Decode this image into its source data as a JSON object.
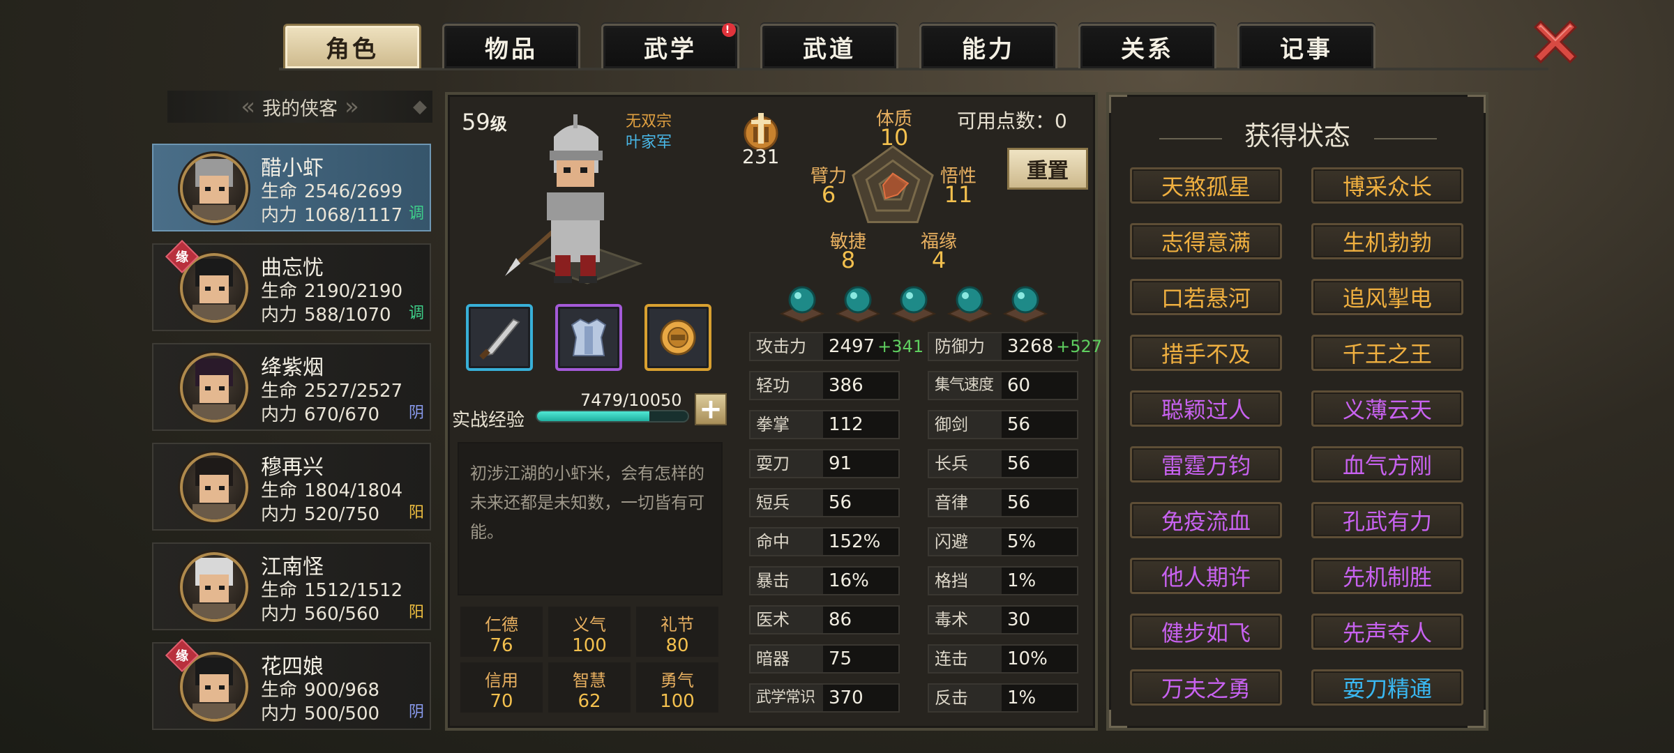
{
  "tabs": [
    {
      "label": "角色",
      "active": true,
      "badge": ""
    },
    {
      "label": "物品",
      "active": false,
      "badge": ""
    },
    {
      "label": "武学",
      "active": false,
      "badge": "!"
    },
    {
      "label": "武道",
      "active": false,
      "badge": ""
    },
    {
      "label": "能力",
      "active": false,
      "badge": ""
    },
    {
      "label": "关系",
      "active": false,
      "badge": ""
    },
    {
      "label": "记事",
      "active": false,
      "badge": ""
    }
  ],
  "character_list": {
    "title": "我的侠客",
    "chars": [
      {
        "name": "醋小虾",
        "hp_label": "生命",
        "hp": "2546/2699",
        "mp_label": "内力",
        "mp": "1068/1117",
        "tag": "调",
        "fate": ""
      },
      {
        "name": "曲忘忧",
        "hp_label": "生命",
        "hp": "2190/2190",
        "mp_label": "内力",
        "mp": "588/1070",
        "tag": "调",
        "fate": "缘"
      },
      {
        "name": "绛紫烟",
        "hp_label": "生命",
        "hp": "2527/2527",
        "mp_label": "内力",
        "mp": "670/670",
        "tag": "阴",
        "fate": ""
      },
      {
        "name": "穆再兴",
        "hp_label": "生命",
        "hp": "1804/1804",
        "mp_label": "内力",
        "mp": "520/750",
        "tag": "阳",
        "fate": ""
      },
      {
        "name": "江南怪",
        "hp_label": "生命",
        "hp": "1512/1512",
        "mp_label": "内力",
        "mp": "560/560",
        "tag": "阳",
        "fate": ""
      },
      {
        "name": "花四娘",
        "hp_label": "生命",
        "hp": "900/968",
        "mp_label": "内力",
        "mp": "500/500",
        "tag": "阴",
        "fate": "缘"
      }
    ]
  },
  "profile": {
    "level_num": "59",
    "level_suffix": "级",
    "sect1": "无双宗",
    "sect2": "叶家军",
    "power": "231",
    "available_points": "可用点数：0",
    "reset_label": "重置",
    "radar": [
      {
        "label": "体质",
        "value": "10"
      },
      {
        "label": "悟性",
        "value": "11"
      },
      {
        "label": "福缘",
        "value": "4"
      },
      {
        "label": "敏捷",
        "value": "8"
      },
      {
        "label": "臂力",
        "value": "6"
      }
    ],
    "exp_label": "实战经验",
    "exp_value": "7479/10050",
    "exp_fraction": 0.744,
    "description": "初涉江湖的小虾米，会有怎样的未来还都是未知数，一切皆有可能。",
    "virtues": [
      {
        "label": "仁德",
        "value": "76"
      },
      {
        "label": "义气",
        "value": "100"
      },
      {
        "label": "礼节",
        "value": "80"
      },
      {
        "label": "信用",
        "value": "70"
      },
      {
        "label": "智慧",
        "value": "62"
      },
      {
        "label": "勇气",
        "value": "100"
      }
    ]
  },
  "stats_left": [
    {
      "label": "攻击力",
      "value": "2497",
      "bonus": "+341"
    },
    {
      "label": "轻功",
      "value": "386",
      "bonus": ""
    },
    {
      "label": "拳掌",
      "value": "112",
      "bonus": ""
    },
    {
      "label": "耍刀",
      "value": "91",
      "bonus": ""
    },
    {
      "label": "短兵",
      "value": "56",
      "bonus": ""
    },
    {
      "label": "命中",
      "value": "152%",
      "bonus": ""
    },
    {
      "label": "暴击",
      "value": "16%",
      "bonus": ""
    },
    {
      "label": "医术",
      "value": "86",
      "bonus": ""
    },
    {
      "label": "暗器",
      "value": "75",
      "bonus": ""
    },
    {
      "label": "武学常识",
      "value": "370",
      "bonus": ""
    }
  ],
  "stats_right": [
    {
      "label": "防御力",
      "value": "3268",
      "bonus": "+527"
    },
    {
      "label": "集气速度",
      "value": "60",
      "bonus": ""
    },
    {
      "label": "御剑",
      "value": "56",
      "bonus": ""
    },
    {
      "label": "长兵",
      "value": "56",
      "bonus": ""
    },
    {
      "label": "音律",
      "value": "56",
      "bonus": ""
    },
    {
      "label": "闪避",
      "value": "5%",
      "bonus": ""
    },
    {
      "label": "格挡",
      "value": "1%",
      "bonus": ""
    },
    {
      "label": "毒术",
      "value": "30",
      "bonus": ""
    },
    {
      "label": "连击",
      "value": "10%",
      "bonus": ""
    },
    {
      "label": "反击",
      "value": "1%",
      "bonus": ""
    }
  ],
  "status_panel": {
    "title": "获得状态",
    "tags": [
      {
        "label": "天煞孤星",
        "color": "orange"
      },
      {
        "label": "博采众长",
        "color": "orange"
      },
      {
        "label": "志得意满",
        "color": "orange"
      },
      {
        "label": "生机勃勃",
        "color": "orange"
      },
      {
        "label": "口若悬河",
        "color": "orange"
      },
      {
        "label": "追风掣电",
        "color": "orange"
      },
      {
        "label": "措手不及",
        "color": "orange"
      },
      {
        "label": "千王之王",
        "color": "orange"
      },
      {
        "label": "聪颖过人",
        "color": "purple"
      },
      {
        "label": "义薄云天",
        "color": "purple"
      },
      {
        "label": "雷霆万钧",
        "color": "purple"
      },
      {
        "label": "血气方刚",
        "color": "purple"
      },
      {
        "label": "免疫流血",
        "color": "purple"
      },
      {
        "label": "孔武有力",
        "color": "purple"
      },
      {
        "label": "他人期许",
        "color": "purple"
      },
      {
        "label": "先机制胜",
        "color": "purple"
      },
      {
        "label": "健步如飞",
        "color": "purple"
      },
      {
        "label": "先声夺人",
        "color": "purple"
      },
      {
        "label": "万夫之勇",
        "color": "purple"
      },
      {
        "label": "耍刀精通",
        "color": "cyan"
      }
    ]
  },
  "colors": {
    "orange_tag": "#f0b040",
    "purple_tag": "#c862f0",
    "cyan_tag": "#3ab8f2",
    "bonus_green": "#5fd060",
    "tab_active_bg": "#e2d2ac"
  }
}
